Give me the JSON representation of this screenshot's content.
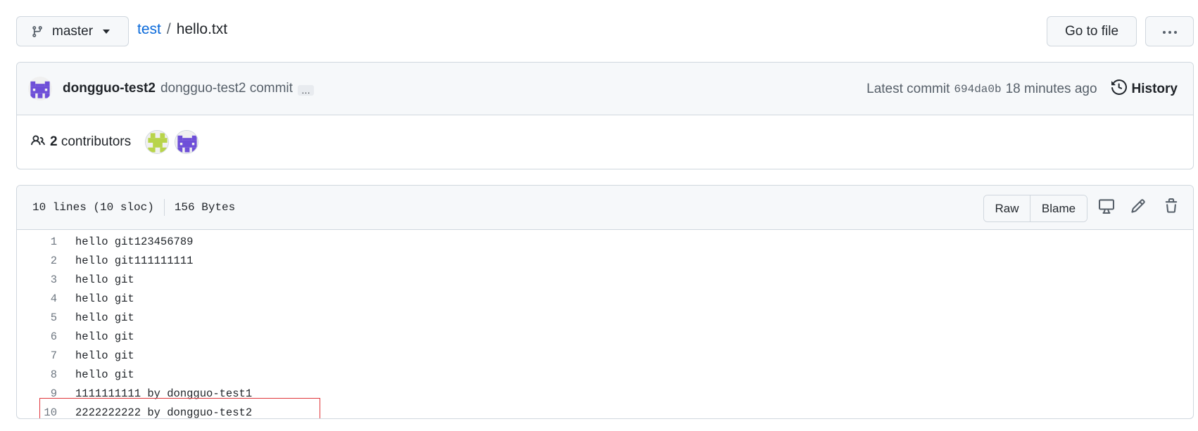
{
  "branch": {
    "name": "master",
    "icon": "git-branch-icon"
  },
  "breadcrumb": {
    "repo": "test",
    "separator": "/",
    "file": "hello.txt"
  },
  "actions": {
    "go_to_file": "Go to file",
    "more": "···"
  },
  "commit": {
    "author": "dongguo-test2",
    "message": "dongguo-test2 commit",
    "ellipsis": "…",
    "latest_label": "Latest commit",
    "sha": "694da0b",
    "time_ago": "18 minutes ago",
    "history_label": "History"
  },
  "contributors": {
    "count": "2",
    "label": "contributors"
  },
  "file": {
    "lines_info": "10 lines (10 sloc)",
    "size": "156 Bytes",
    "raw_label": "Raw",
    "blame_label": "Blame",
    "lines": [
      {
        "num": "1",
        "text": "hello git123456789"
      },
      {
        "num": "2",
        "text": "hello git111111111"
      },
      {
        "num": "3",
        "text": "hello git"
      },
      {
        "num": "4",
        "text": "hello git"
      },
      {
        "num": "5",
        "text": "hello git"
      },
      {
        "num": "6",
        "text": "hello git"
      },
      {
        "num": "7",
        "text": "hello git"
      },
      {
        "num": "8",
        "text": "hello git"
      },
      {
        "num": "9",
        "text": "1111111111 by dongguo-test1"
      },
      {
        "num": "10",
        "text": "2222222222 by dongguo-test2"
      }
    ]
  },
  "colors": {
    "link": "#0969da",
    "highlight_border": "#e0353b",
    "avatar_purple": "#6e4fd8",
    "avatar_green": "#b8d44a"
  }
}
